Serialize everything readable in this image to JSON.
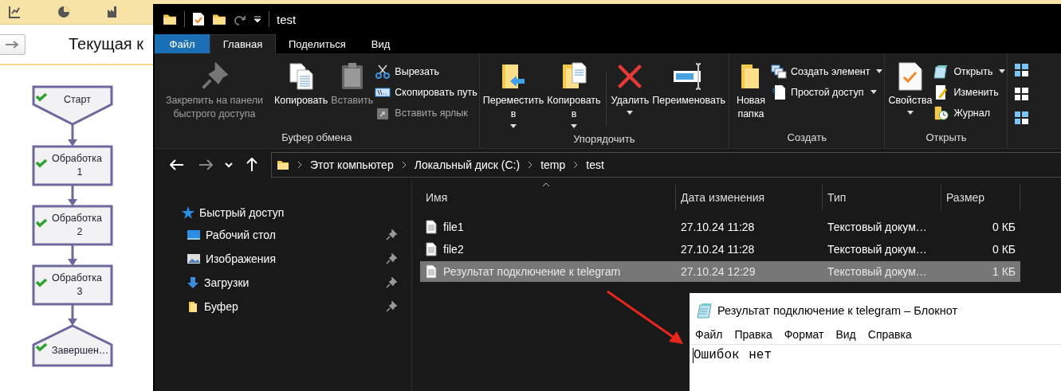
{
  "background_app": {
    "title": "Текущая к",
    "flow": [
      {
        "kind": "start",
        "label": "Старт",
        "done": true
      },
      {
        "kind": "task",
        "label": "Обработка 1",
        "done": true
      },
      {
        "kind": "task",
        "label": "Обработка 2",
        "done": true
      },
      {
        "kind": "task",
        "label": "Обработка 3",
        "done": true
      },
      {
        "kind": "end",
        "label": "Завершен…",
        "done": true
      }
    ]
  },
  "explorer": {
    "title": "test",
    "tabs": [
      {
        "label": "Файл",
        "kind": "menu",
        "selected": false
      },
      {
        "label": "Главная",
        "kind": "tab",
        "selected": true
      },
      {
        "label": "Поделиться",
        "kind": "tab",
        "selected": false
      },
      {
        "label": "Вид",
        "kind": "tab",
        "selected": false
      }
    ],
    "ribbon": [
      {
        "label": "Буфер обмена",
        "controls": [
          {
            "kind": "large",
            "label": "Закрепить на панели быстрого доступа",
            "dropdown": false,
            "disabled": true
          },
          {
            "kind": "large",
            "label": "Копировать",
            "dropdown": false,
            "disabled": false
          },
          {
            "kind": "large",
            "label": "Вставить",
            "dropdown": false,
            "disabled": true
          },
          {
            "kind": "stack",
            "items": [
              {
                "label": "Вырезать",
                "dropdown": false,
                "disabled": false
              },
              {
                "label": "Скопировать путь",
                "dropdown": false,
                "disabled": false
              },
              {
                "label": "Вставить ярлык",
                "dropdown": false,
                "disabled": true
              }
            ]
          }
        ]
      },
      {
        "label": "Упорядочить",
        "controls": [
          {
            "kind": "large",
            "label": "Переместить в",
            "dropdown": true,
            "disabled": false
          },
          {
            "kind": "large",
            "label": "Копировать в",
            "dropdown": true,
            "disabled": false
          },
          {
            "kind": "separator"
          },
          {
            "kind": "large",
            "label": "Удалить",
            "dropdown": true,
            "disabled": false
          },
          {
            "kind": "large",
            "label": "Переименовать",
            "dropdown": false,
            "disabled": false
          }
        ]
      },
      {
        "label": "Создать",
        "controls": [
          {
            "kind": "large",
            "label": "Новая папка",
            "dropdown": false,
            "disabled": false
          },
          {
            "kind": "stack",
            "items": [
              {
                "label": "Создать элемент",
                "dropdown": true,
                "disabled": false
              },
              {
                "label": "Простой доступ",
                "dropdown": true,
                "disabled": false
              }
            ]
          }
        ]
      },
      {
        "label": "Открыть",
        "controls": [
          {
            "kind": "large",
            "label": "Свойства",
            "dropdown": true,
            "disabled": false
          },
          {
            "kind": "stack",
            "items": [
              {
                "label": "Открыть",
                "dropdown": true,
                "disabled": false
              },
              {
                "label": "Изменить",
                "dropdown": false,
                "disabled": false
              },
              {
                "label": "Журнал",
                "dropdown": false,
                "disabled": false
              }
            ]
          }
        ]
      }
    ],
    "address": [
      "Этот компьютер",
      "Локальный диск (C:)",
      "temp",
      "test"
    ],
    "navigation": [
      {
        "label": "Быстрый доступ",
        "children": [
          {
            "label": "Рабочий стол",
            "pinned": true
          },
          {
            "label": "Изображения",
            "pinned": true
          },
          {
            "label": "Загрузки",
            "pinned": true
          },
          {
            "label": "Буфер",
            "pinned": true
          }
        ]
      }
    ],
    "columns": [
      "Имя",
      "Дата изменения",
      "Тип",
      "Размер"
    ],
    "files": [
      {
        "name": "file1",
        "modified": "27.10.24 11:28",
        "type": "Текстовый докум…",
        "size": "0 КБ",
        "selected": false
      },
      {
        "name": "file2",
        "modified": "27.10.24 11:28",
        "type": "Текстовый докум…",
        "size": "0 КБ",
        "selected": false
      },
      {
        "name": "Результат подключение к telegram",
        "modified": "27.10.24 12:29",
        "type": "Текстовый докум…",
        "size": "1 КБ",
        "selected": true
      }
    ]
  },
  "notepad": {
    "title": "Результат подключение к telegram – Блокнот",
    "menu": [
      "Файл",
      "Правка",
      "Формат",
      "Вид",
      "Справка"
    ],
    "content": "Ошибок нет"
  }
}
